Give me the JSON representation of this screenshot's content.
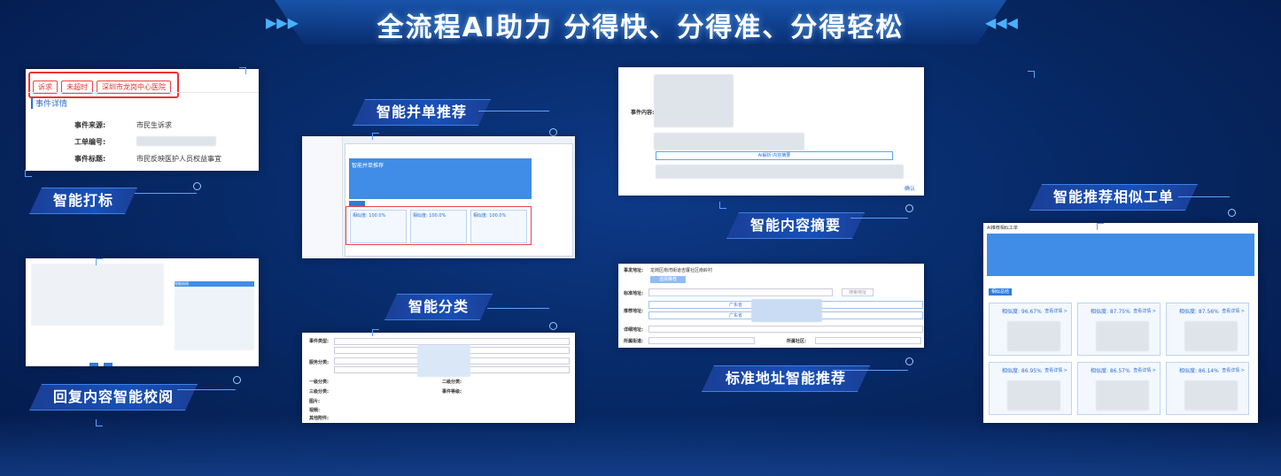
{
  "title": "全流程AI助力  分得快、分得准、分得轻松",
  "labels": {
    "tagging": "智能打标",
    "merge": "智能并单推荐",
    "summary": "智能内容摘要",
    "similar": "智能推荐相似工单",
    "review": "回复内容智能校阅",
    "classify": "智能分类",
    "address": "标准地址智能推荐"
  },
  "tagging_card": {
    "tags": [
      "诉求",
      "未超时",
      "深圳市龙岗中心医院"
    ],
    "section": "事件详情",
    "rows": [
      {
        "k": "事件来源:",
        "v": "市民生诉求"
      },
      {
        "k": "工单编号:",
        "v": ""
      },
      {
        "k": "事件标题:",
        "v": "市民反映医护人员权益事宜"
      }
    ]
  },
  "merge_card": {
    "header": "智能并单推荐",
    "recommend_label": "推荐列表",
    "similarities": [
      "相似度: 100.0%",
      "相似度: 100.0%",
      "相似度: 100.0%"
    ],
    "detail_link": "查看详情"
  },
  "summary_card": {
    "content_label": "事件内容:",
    "button": "AI解析·内容摘要",
    "ok": "确认"
  },
  "similar_card": {
    "title": "AI推荐相似工单",
    "button": "相似总结",
    "items": [
      {
        "sim": "相似度: 96.67%",
        "link": "查看详情 >"
      },
      {
        "sim": "相似度: 87.75%",
        "link": "查看详情 >"
      },
      {
        "sim": "相似度: 87.56%",
        "link": "查看详情 >"
      },
      {
        "sim": "相似度: 86.95%",
        "link": "查看详情 >"
      },
      {
        "sim": "相似度: 86.57%",
        "link": "查看详情 >"
      },
      {
        "sim": "相似度: 86.14%",
        "link": "查看详情 >"
      }
    ]
  },
  "review_card": {
    "header": "智能校阅"
  },
  "classify_card": {
    "rows": [
      "事件类型:",
      "服务分类:",
      "一级分类:",
      "二级分类:",
      "三级分类:",
      "事件等级:",
      "图片:",
      "视频:",
      "其他附件:"
    ]
  },
  "address_card": {
    "rows": [
      {
        "k": "事发地址:",
        "v": "龙岗区南湾街道吉厦社区南岭村"
      },
      {
        "k": "标准地址:",
        "v": ""
      },
      {
        "k": "推荐地址:",
        "v": "广东省"
      },
      {
        "k": "详细地址:",
        "v": ""
      },
      {
        "k": "所属街道:",
        "v": ""
      },
      {
        "k": "所属社区:",
        "v": ""
      }
    ],
    "button": "选择推荐",
    "search": "搜索地址"
  },
  "colors": {
    "accent": "#3d82e6",
    "bg": "#072a68"
  }
}
